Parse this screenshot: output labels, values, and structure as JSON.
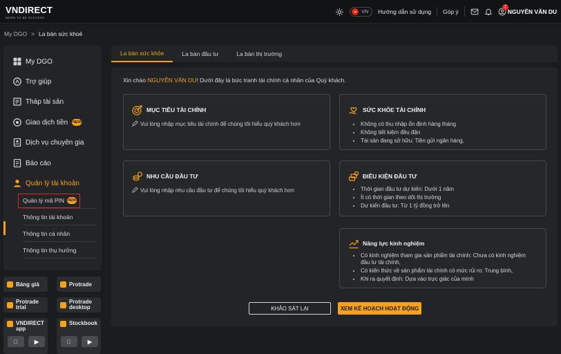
{
  "header": {
    "brand": "VNDIRECT",
    "tagline": "WHEN TO BE SUCCESS",
    "lang": "VN",
    "guide_link": "Hướng dẫn sử dụng",
    "feedback_link": "Góp ý",
    "notification_count": "7",
    "user_name": "NGUYỄN VĂN DU"
  },
  "breadcrumb": {
    "root": "My DGO",
    "separator": ">",
    "current": "La bàn sức khoẻ"
  },
  "sidebar": {
    "items": [
      {
        "label": "My DGO",
        "icon": "grid-icon"
      },
      {
        "label": "Trợ giúp",
        "icon": "help-icon"
      },
      {
        "label": "Tháp tài sản",
        "icon": "tower-icon"
      },
      {
        "label": "Giao dịch tiền",
        "icon": "money-icon",
        "badge": "NEW"
      },
      {
        "label": "Dịch vụ chuyên gia",
        "icon": "expert-icon"
      },
      {
        "label": "Báo cáo",
        "icon": "report-icon"
      },
      {
        "label": "Quản lý tài khoản",
        "icon": "user-icon",
        "active": true
      }
    ],
    "sub_items": [
      {
        "label": "Quản lý mã PIN",
        "badge": "NEW"
      },
      {
        "label": "Thông tin tài khoản"
      },
      {
        "label": "Thông tin cá nhân"
      },
      {
        "label": "Thông tin thụ hưởng"
      }
    ],
    "tiles": [
      {
        "label": "Bảng giá"
      },
      {
        "label": "Protrade"
      },
      {
        "line1": "Protrade",
        "line2": "trial"
      },
      {
        "line1": "Protrade",
        "line2": "desktop"
      },
      {
        "line1": "VNDIRECT",
        "line2": "app"
      },
      {
        "label": "Stockbook"
      }
    ]
  },
  "tabs": [
    {
      "label": "La bàn sức khỏe",
      "active": true
    },
    {
      "label": "La bàn đầu tư"
    },
    {
      "label": "La bàn thị trường"
    }
  ],
  "main": {
    "greeting_prefix": "Xin chào ",
    "greeting_name": "NGUYỄN VĂN DU",
    "greeting_suffix": "! Dưới đây là bức tranh tài chính cá nhân của Quý khách.",
    "cards": {
      "goal": {
        "title": "MỤC TIÊU TÀI CHÍNH",
        "text": "Vui lòng nhập mục tiêu tài chính để chúng tôi hiểu quý khách hơn"
      },
      "needs": {
        "title": "NHU CẦU ĐẦU TƯ",
        "text": "Vui lòng nhập nhu cầu đầu tư để chúng tôi hiểu quý khách hơn"
      },
      "health": {
        "title": "SỨC KHỎE TÀI CHÍNH",
        "items": [
          "Không có thu nhập ổn định hàng tháng",
          "Không tiết kiệm đều đặn",
          "Tài sản đang sở hữu: Tiền gửi ngân hàng,"
        ]
      },
      "conditions": {
        "title": "ĐIỀU KIỆN ĐẦU TƯ",
        "items": [
          "Thời gian đầu tư dự kiến: Dưới 1 năm",
          "Ít có thời gian theo dõi thị trường",
          "Dự kiến đầu tư: Từ 1 tỷ đồng trở lên"
        ]
      },
      "experience": {
        "title": "Năng lực kinh nghiệm",
        "items": [
          "Có kinh nghiệm tham gia sản phẩm tài chính: Chưa có kinh nghiệm đầu tư tài chính,",
          "Có kiến thức về sản phẩm tài chính có mức rủi ro: Trung bình,",
          "Khi ra quyết định: Dựa vào trực giác của mình"
        ]
      }
    },
    "survey_button": "KHẢO SÁT LẠI",
    "plan_button": "XEM KẾ HOẠCH HOẠT ĐỘNG"
  },
  "colors": {
    "accent": "#f7a21b",
    "background": "#1b1c1e",
    "panel": "#232427",
    "highlight_box": "#e0282e"
  }
}
